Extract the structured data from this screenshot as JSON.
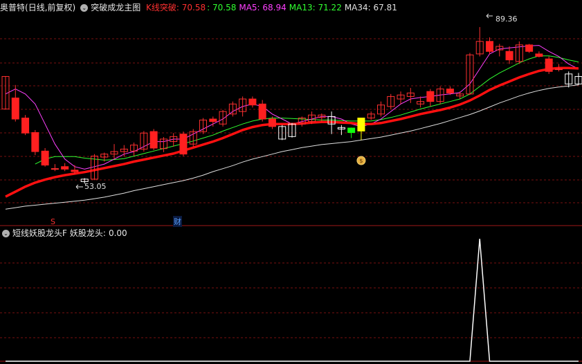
{
  "main_panel": {
    "stock_name": "奥普特",
    "period": "(日线,前复权)",
    "indicator_name": "突破成龙主图",
    "readouts": [
      {
        "label": "K线突破:",
        "value": "70.58",
        "color": "#ff3030"
      },
      {
        "label": ":",
        "value": "70.58",
        "color": "#30ff30"
      },
      {
        "label": "MA5:",
        "value": "68.94",
        "color": "#ff40ff"
      },
      {
        "label": "MA13:",
        "value": "71.22",
        "color": "#30ff30"
      },
      {
        "label": "MA34:",
        "value": "67.81",
        "color": "#e0e0e0"
      }
    ],
    "high_annotation": "89.36",
    "low_annotation": "53.05",
    "marker_s": "S",
    "marker_cai": "财"
  },
  "sub_panel": {
    "indicator_name": "短线妖股龙头F",
    "readout_label": "妖股龙头:",
    "readout_value": "0.00"
  },
  "colors": {
    "up": "#ff3030",
    "down_fill": "#ff2020",
    "hollow_up": "#ffffff",
    "ma5": "#ff40ff",
    "ma13": "#30ff30",
    "ma34": "#e0e0e0",
    "thick": "#ff1010",
    "grid": "#7a1010",
    "yellow": "#ffff00",
    "green_candle": "#10ff10"
  },
  "chart_data": [
    {
      "type": "candlestick",
      "title": "突破成龙主图",
      "ylim": [
        50,
        92
      ],
      "candles": [
        {
          "o": 73.0,
          "h": 79.5,
          "l": 73.0,
          "c": 79.5,
          "col": "red"
        },
        {
          "o": 75.2,
          "h": 77.8,
          "l": 70.5,
          "c": 71.0,
          "col": "red"
        },
        {
          "o": 71.2,
          "h": 71.8,
          "l": 67.8,
          "c": 68.2,
          "col": "red"
        },
        {
          "o": 68.3,
          "h": 68.8,
          "l": 63.8,
          "c": 64.5,
          "col": "red"
        },
        {
          "o": 64.6,
          "h": 65.2,
          "l": 61.5,
          "c": 61.8,
          "col": "red"
        },
        {
          "o": 61.0,
          "h": 62.0,
          "l": 60.6,
          "c": 61.1,
          "col": "red"
        },
        {
          "o": 61.5,
          "h": 62.2,
          "l": 60.6,
          "c": 61.0,
          "col": "red"
        },
        {
          "o": 60.8,
          "h": 61.8,
          "l": 60.0,
          "c": 60.5,
          "col": "red"
        },
        {
          "o": 58.5,
          "h": 59.2,
          "l": 58.1,
          "c": 59.0,
          "col": "white"
        },
        {
          "o": 59.0,
          "h": 64.0,
          "l": 58.8,
          "c": 63.6,
          "col": "red"
        },
        {
          "o": 63.4,
          "h": 64.3,
          "l": 62.5,
          "c": 64.0,
          "col": "red"
        },
        {
          "o": 64.0,
          "h": 66.0,
          "l": 63.0,
          "c": 64.5,
          "col": "red"
        },
        {
          "o": 64.5,
          "h": 65.8,
          "l": 63.5,
          "c": 65.0,
          "col": "red"
        },
        {
          "o": 64.6,
          "h": 66.3,
          "l": 63.6,
          "c": 65.8,
          "col": "red"
        },
        {
          "o": 65.0,
          "h": 68.6,
          "l": 64.5,
          "c": 68.2,
          "col": "red"
        },
        {
          "o": 68.5,
          "h": 69.0,
          "l": 64.8,
          "c": 65.2,
          "col": "red"
        },
        {
          "o": 65.1,
          "h": 67.4,
          "l": 64.4,
          "c": 67.0,
          "col": "red"
        },
        {
          "o": 66.5,
          "h": 68.2,
          "l": 65.5,
          "c": 67.5,
          "col": "red"
        },
        {
          "o": 68.0,
          "h": 68.5,
          "l": 63.6,
          "c": 64.0,
          "col": "red"
        },
        {
          "o": 66.0,
          "h": 69.0,
          "l": 65.5,
          "c": 68.5,
          "col": "red"
        },
        {
          "o": 68.5,
          "h": 71.2,
          "l": 68.0,
          "c": 70.8,
          "col": "red"
        },
        {
          "o": 71.0,
          "h": 71.5,
          "l": 69.5,
          "c": 70.5,
          "col": "red"
        },
        {
          "o": 70.0,
          "h": 72.8,
          "l": 69.5,
          "c": 72.5,
          "col": "red"
        },
        {
          "o": 72.0,
          "h": 74.5,
          "l": 71.5,
          "c": 74.0,
          "col": "red"
        },
        {
          "o": 72.5,
          "h": 75.5,
          "l": 71.5,
          "c": 75.0,
          "col": "red"
        },
        {
          "o": 75.0,
          "h": 75.5,
          "l": 73.3,
          "c": 73.8,
          "col": "red"
        },
        {
          "o": 74.0,
          "h": 74.8,
          "l": 70.5,
          "c": 71.0,
          "col": "red"
        },
        {
          "o": 71.0,
          "h": 71.5,
          "l": 69.0,
          "c": 69.5,
          "col": "red"
        },
        {
          "o": 67.0,
          "h": 69.8,
          "l": 66.8,
          "c": 69.5,
          "col": "white"
        },
        {
          "o": 67.5,
          "h": 70.2,
          "l": 67.3,
          "c": 70.0,
          "col": "white"
        },
        {
          "o": 70.0,
          "h": 71.5,
          "l": 69.5,
          "c": 71.2,
          "col": "red"
        },
        {
          "o": 70.5,
          "h": 72.5,
          "l": 70.0,
          "c": 71.8,
          "col": "red"
        },
        {
          "o": 71.3,
          "h": 72.1,
          "l": 70.5,
          "c": 71.8,
          "col": "red"
        },
        {
          "o": 70.0,
          "h": 72.5,
          "l": 68.0,
          "c": 71.5,
          "col": "white"
        },
        {
          "o": 69.3,
          "h": 69.8,
          "l": 67.8,
          "c": 69.0,
          "col": "white"
        },
        {
          "o": 68.3,
          "h": 69.3,
          "l": 67.2,
          "c": 69.2,
          "col": "green"
        },
        {
          "o": 68.6,
          "h": 71.2,
          "l": 66.8,
          "c": 71.2,
          "col": "yellow"
        },
        {
          "o": 71.2,
          "h": 72.5,
          "l": 70.8,
          "c": 72.0,
          "col": "red"
        },
        {
          "o": 72.0,
          "h": 74.5,
          "l": 71.5,
          "c": 73.8,
          "col": "red"
        },
        {
          "o": 73.5,
          "h": 76.0,
          "l": 73.0,
          "c": 75.5,
          "col": "red"
        },
        {
          "o": 75.0,
          "h": 76.5,
          "l": 74.0,
          "c": 75.8,
          "col": "red"
        },
        {
          "o": 75.5,
          "h": 77.2,
          "l": 74.2,
          "c": 76.2,
          "col": "red"
        },
        {
          "o": 74.0,
          "h": 75.5,
          "l": 73.3,
          "c": 74.5,
          "col": "red"
        },
        {
          "o": 76.5,
          "h": 77.0,
          "l": 73.5,
          "c": 74.5,
          "col": "red"
        },
        {
          "o": 74.5,
          "h": 77.5,
          "l": 74.0,
          "c": 77.0,
          "col": "red"
        },
        {
          "o": 77.0,
          "h": 77.5,
          "l": 75.8,
          "c": 76.2,
          "col": "red"
        },
        {
          "o": 75.6,
          "h": 76.5,
          "l": 75.0,
          "c": 76.0,
          "col": "red"
        },
        {
          "o": 76.0,
          "h": 84.2,
          "l": 75.8,
          "c": 83.8,
          "col": "red"
        },
        {
          "o": 84.0,
          "h": 89.36,
          "l": 83.5,
          "c": 86.5,
          "col": "red"
        },
        {
          "o": 86.5,
          "h": 87.3,
          "l": 84.0,
          "c": 84.5,
          "col": "red"
        },
        {
          "o": 84.8,
          "h": 86.0,
          "l": 83.5,
          "c": 85.5,
          "col": "red"
        },
        {
          "o": 84.5,
          "h": 85.5,
          "l": 82.0,
          "c": 82.8,
          "col": "red"
        },
        {
          "o": 82.5,
          "h": 86.5,
          "l": 82.0,
          "c": 85.8,
          "col": "red"
        },
        {
          "o": 85.8,
          "h": 86.0,
          "l": 84.2,
          "c": 84.5,
          "col": "red"
        },
        {
          "o": 84.0,
          "h": 84.5,
          "l": 83.3,
          "c": 83.5,
          "col": "red"
        },
        {
          "o": 83.0,
          "h": 83.5,
          "l": 80.0,
          "c": 80.5,
          "col": "red"
        },
        {
          "o": 81.0,
          "h": 82.0,
          "l": 80.5,
          "c": 81.0,
          "col": "red"
        },
        {
          "o": 78.0,
          "h": 80.5,
          "l": 77.3,
          "c": 80.0,
          "col": "white"
        },
        {
          "o": 78.0,
          "h": 80.2,
          "l": 77.8,
          "c": 79.5,
          "col": "white"
        }
      ],
      "series": [
        {
          "name": "MA5",
          "color": "#ff40ff",
          "values": [
            76,
            77,
            76,
            74,
            70,
            66,
            63,
            61.5,
            61,
            61.5,
            62,
            63,
            64,
            64.5,
            65.5,
            66.5,
            66.5,
            67,
            67,
            68,
            69,
            70,
            71,
            72.5,
            73.5,
            74,
            73.5,
            72,
            71,
            70,
            70.5,
            71,
            71.5,
            71.5,
            71,
            70,
            69.5,
            70,
            71,
            72.5,
            74,
            75,
            75.3,
            75.5,
            75.8,
            76,
            76.3,
            78,
            81,
            84,
            85,
            85.2,
            85.4,
            85.6,
            85.7,
            84.5,
            83.5,
            82,
            81
          ]
        },
        {
          "name": "MA13",
          "color": "#30ff30",
          "values": [
            null,
            null,
            null,
            62,
            63,
            63.5,
            63.5,
            63.5,
            63.2,
            63,
            62.8,
            62.9,
            63.1,
            63.6,
            64.1,
            64.6,
            65.1,
            65.6,
            66.1,
            66.6,
            67.2,
            67.8,
            68.6,
            69.3,
            70.0,
            70.6,
            71.0,
            71.2,
            71.2,
            71.1,
            71.0,
            70.9,
            70.8,
            70.8,
            70.7,
            70.6,
            70.6,
            70.6,
            70.9,
            71.3,
            71.8,
            72.4,
            73.0,
            73.5,
            74.0,
            74.5,
            75.0,
            76.0,
            77.5,
            79.0,
            80.2,
            81.2,
            82.2,
            83.0,
            83.6,
            83.6,
            83.3,
            82.8,
            82.4
          ]
        },
        {
          "name": "K线突破",
          "color": "#ff1010",
          "values": [
            55.5,
            56.5,
            57.5,
            58.3,
            58.9,
            59.4,
            59.8,
            60.1,
            60.4,
            60.8,
            61.2,
            61.6,
            62.0,
            62.5,
            62.9,
            63.3,
            63.7,
            64.1,
            64.7,
            65.3,
            65.9,
            66.5,
            67.2,
            68.0,
            68.8,
            69.4,
            69.8,
            70.0,
            70.0,
            70.0,
            70.1,
            70.3,
            70.4,
            70.4,
            70.3,
            70.2,
            70.0,
            70.0,
            70.2,
            70.6,
            71.0,
            71.5,
            72.0,
            72.4,
            72.8,
            73.3,
            73.9,
            74.7,
            75.7,
            76.8,
            77.7,
            78.5,
            79.3,
            80.0,
            80.6,
            81.0,
            81.2,
            81.2,
            81.1
          ]
        },
        {
          "name": "MA34",
          "color": "#e0e0e0",
          "values": [
            53.0,
            53.3,
            53.6,
            53.8,
            54.0,
            54.2,
            54.4,
            54.6,
            54.8,
            55.1,
            55.4,
            55.8,
            56.2,
            56.7,
            57.1,
            57.5,
            57.9,
            58.3,
            58.7,
            59.2,
            59.8,
            60.5,
            61.1,
            61.7,
            62.4,
            63.0,
            63.5,
            64.0,
            64.5,
            64.9,
            65.3,
            65.6,
            65.9,
            66.1,
            66.3,
            66.5,
            66.8,
            67.1,
            67.4,
            67.8,
            68.2,
            68.6,
            69.1,
            69.6,
            70.1,
            70.7,
            71.3,
            71.9,
            72.6,
            73.4,
            74.2,
            74.9,
            75.6,
            76.2,
            76.7,
            77.1,
            77.4,
            77.6,
            77.8
          ]
        }
      ]
    },
    {
      "type": "line",
      "title": "短线妖股龙头F",
      "ylim": [
        0,
        1
      ],
      "series": [
        {
          "name": "妖股龙头",
          "color": "#ffffff",
          "values": [
            0,
            0,
            0,
            0,
            0,
            0,
            0,
            0,
            0,
            0,
            0,
            0,
            0,
            0,
            0,
            0,
            0,
            0,
            0,
            0,
            0,
            0,
            0,
            0,
            0,
            0,
            0,
            0,
            0,
            0,
            0,
            0,
            0,
            0,
            0,
            0,
            0,
            0,
            0,
            0,
            0,
            0,
            0,
            0,
            0,
            0,
            0,
            0,
            1,
            0,
            0,
            0,
            0,
            0,
            0,
            0,
            0,
            0,
            0
          ]
        }
      ]
    }
  ]
}
